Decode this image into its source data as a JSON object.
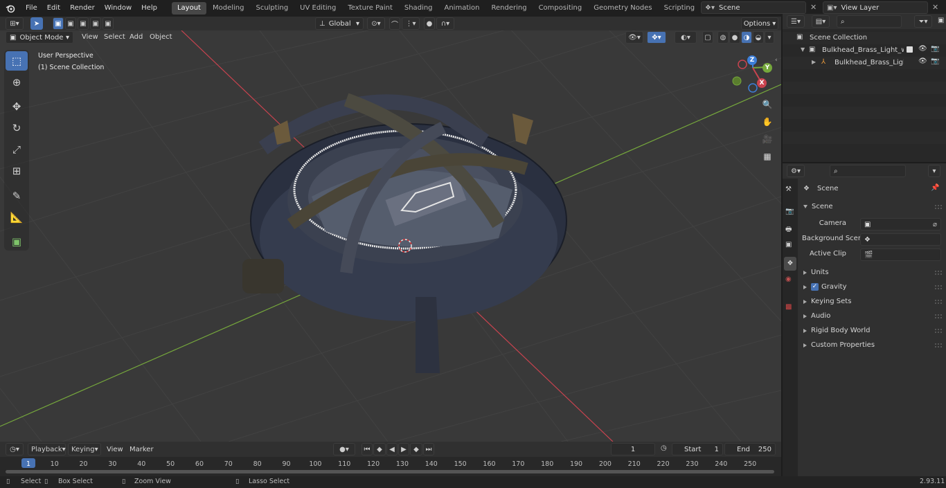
{
  "menu": [
    "File",
    "Edit",
    "Render",
    "Window",
    "Help"
  ],
  "workspaces": [
    "Layout",
    "Modeling",
    "Sculpting",
    "UV Editing",
    "Texture Paint",
    "Shading",
    "Animation",
    "Rendering",
    "Compositing",
    "Geometry Nodes",
    "Scripting"
  ],
  "scene_field": "Scene",
  "view_layer_field": "View Layer",
  "viewport_header": {
    "mode": "Object Mode",
    "menus": [
      "View",
      "Select",
      "Add",
      "Object"
    ],
    "transform_orientation": "Global",
    "options": "Options"
  },
  "viewport": {
    "perspective": "User Perspective",
    "collection": "(1) Scene Collection",
    "gizmo": {
      "x": "X",
      "y": "Y",
      "z": "Z"
    }
  },
  "outliner": {
    "root": "Scene Collection",
    "items": [
      "Bulkhead_Brass_Light_with_C",
      "Bulkhead_Brass_Light_w"
    ]
  },
  "properties": {
    "title": "Scene",
    "panel": "Scene",
    "fields": [
      {
        "label": "Camera"
      },
      {
        "label": "Background Scene"
      },
      {
        "label": "Active Clip"
      }
    ],
    "subpanels": [
      "Units",
      "Gravity",
      "Keying Sets",
      "Audio",
      "Rigid Body World",
      "Custom Properties"
    ]
  },
  "timeline": {
    "menus": [
      "Playback",
      "Keying",
      "View",
      "Marker"
    ],
    "current_frame": "1",
    "start_label": "Start",
    "start": "1",
    "end_label": "End",
    "end": "250",
    "ticks": [
      "1",
      "10",
      "20",
      "30",
      "40",
      "50",
      "60",
      "70",
      "80",
      "90",
      "100",
      "110",
      "120",
      "130",
      "140",
      "150",
      "160",
      "170",
      "180",
      "190",
      "200",
      "210",
      "220",
      "230",
      "240",
      "250"
    ]
  },
  "status": {
    "select": "Select",
    "box_select": "Box Select",
    "zoom_view": "Zoom View",
    "lasso_select": "Lasso Select",
    "version": "2.93.11"
  },
  "colors": {
    "accent": "#4772b3",
    "x_axis": "#c9434f",
    "y_axis": "#76a83c",
    "z_axis": "#3d7fd9"
  }
}
